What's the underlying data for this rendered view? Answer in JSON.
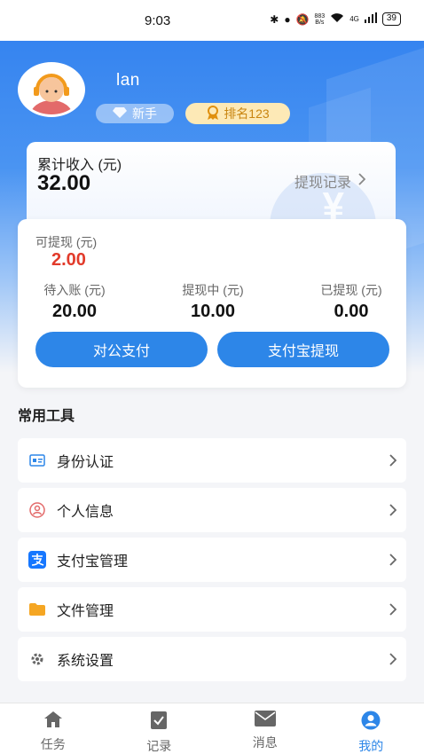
{
  "status_bar": {
    "time": "9:03",
    "net_speed_top": "883",
    "net_speed_bottom": "B/s",
    "network": "4G",
    "battery": "39"
  },
  "profile": {
    "username": "lan",
    "level_badge": "新手",
    "rank_badge": "排名123"
  },
  "income": {
    "label": "累计收入 (元)",
    "value": "32.00",
    "record_link": "提现记录",
    "currency_symbol": "¥"
  },
  "balance": {
    "available_label": "可提现 (元)",
    "available_value": "2.00",
    "stats": [
      {
        "label": "待入账 (元)",
        "value": "20.00"
      },
      {
        "label": "提现中 (元)",
        "value": "10.00"
      },
      {
        "label": "已提现 (元)",
        "value": "0.00"
      }
    ],
    "buttons": {
      "corporate_pay": "对公支付",
      "alipay_withdraw": "支付宝提现"
    }
  },
  "tools": {
    "title": "常用工具",
    "items": [
      {
        "label": "身份认证",
        "icon": "id-card-icon"
      },
      {
        "label": "个人信息",
        "icon": "person-icon"
      },
      {
        "label": "支付宝管理",
        "icon": "alipay-icon"
      },
      {
        "label": "文件管理",
        "icon": "folder-icon"
      },
      {
        "label": "系统设置",
        "icon": "gear-icon"
      }
    ]
  },
  "tabbar": {
    "items": [
      {
        "label": "任务",
        "icon": "home-icon",
        "active": false
      },
      {
        "label": "记录",
        "icon": "record-icon",
        "active": false
      },
      {
        "label": "消息",
        "icon": "mail-icon",
        "active": false
      },
      {
        "label": "我的",
        "icon": "user-icon",
        "active": true
      }
    ]
  },
  "colors": {
    "primary": "#2d86e8",
    "available_amount": "#e23b2b",
    "rank_badge_bg": "#fde9b6",
    "rank_badge_text": "#c98510"
  }
}
